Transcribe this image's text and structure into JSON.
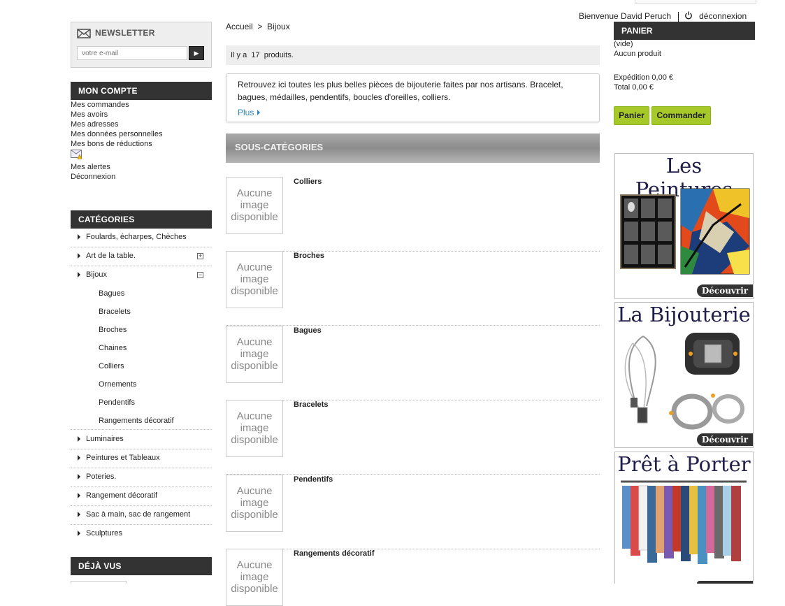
{
  "header": {
    "welcome": "Bienvenue David Peruch",
    "logout": "déconnexion"
  },
  "newsletter": {
    "title": "NEWSLETTER",
    "placeholder": "votre e-mail",
    "submit": "▶"
  },
  "account": {
    "title": "MON COMPTE",
    "links": [
      "Mes commandes",
      "Mes avoirs",
      "Mes adresses",
      "Mes données personnelles",
      "Mes bons de réductions"
    ],
    "alerts": "Mes alertes",
    "logout": "Déconnexion"
  },
  "categories": {
    "title": "CATÉGORIES",
    "items": [
      {
        "label": "Foulards, écharpes, Chèches"
      },
      {
        "label": "Art de la table.",
        "toggle": "+"
      },
      {
        "label": "Bijoux",
        "toggle": "−"
      },
      {
        "label": "Luminaires"
      },
      {
        "label": "Peintures et Tableaux"
      },
      {
        "label": "Poteries."
      },
      {
        "label": "Rangement décoratif"
      },
      {
        "label": "Sac à main, sac de rangement"
      },
      {
        "label": "Sculptures"
      }
    ],
    "bijoux_sub": [
      "Bagues",
      "Bracelets",
      "Broches",
      "Chaines",
      "Colliers",
      "Ornements",
      "Pendentifs",
      "Rangements décoratif"
    ]
  },
  "viewed": {
    "title": "DÉJÀ VUS"
  },
  "breadcrumb": {
    "home": "Accueil",
    "sep": ">",
    "current": "Bijoux"
  },
  "product_count": {
    "prefix": "Il y a",
    "count": "17",
    "suffix": "produits."
  },
  "description": {
    "text": "Retrouvez ici toutes les plus belles pièces de bijouterie faites par nos artisans. Bracelet, bagues, médailles, pendentifs, boucles d'oreilles, colliers.",
    "more": "Plus"
  },
  "subcategories": {
    "title": "SOUS-CATÉGORIES",
    "no_image": "Aucune image disponible",
    "items": [
      "Colliers",
      "Broches",
      "Bagues",
      "Bracelets",
      "Pendentifs",
      "Rangements décoratif"
    ]
  },
  "cart": {
    "title": "PANIER",
    "empty": "(vide)",
    "no_product": "Aucun produit",
    "shipping": "Expédition 0,00 €",
    "total": "Total 0,00 €",
    "cart_button": "Panier",
    "order_button": "Commander"
  },
  "banners": [
    {
      "title": "Les Peintures",
      "cta": "Découvrir"
    },
    {
      "title": "La Bijouterie",
      "cta": "Découvrir"
    },
    {
      "title": "Prêt à Porter"
    }
  ],
  "colors": {
    "accent": "#a6c829",
    "dark": "#333333",
    "link": "#2a86c8"
  }
}
